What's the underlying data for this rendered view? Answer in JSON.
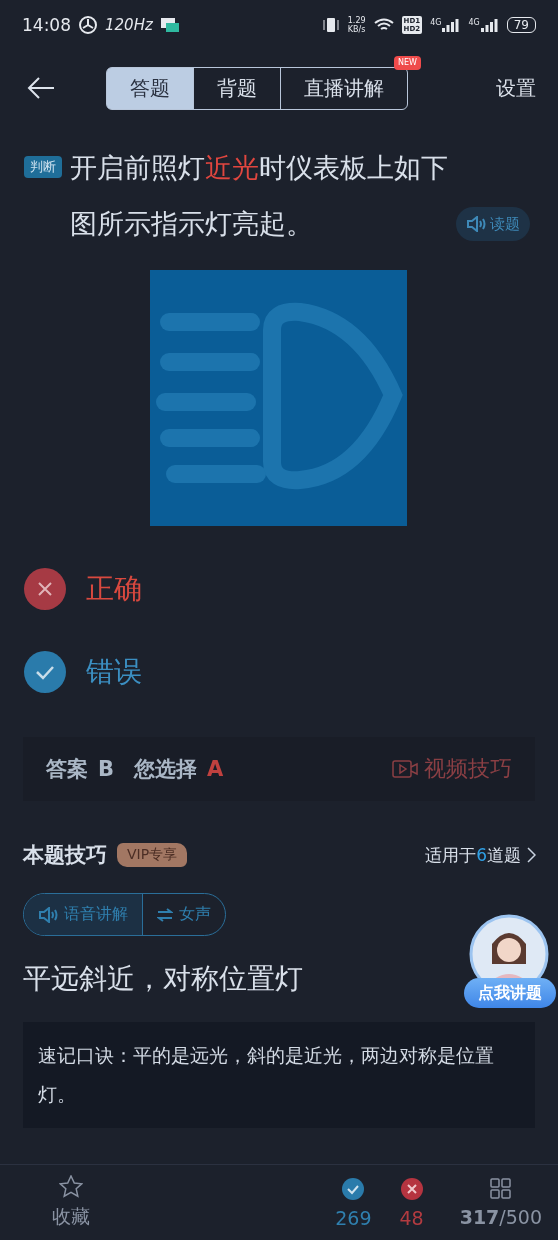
{
  "status_bar": {
    "time": "14:08",
    "refresh": "120Hz",
    "speed": [
      "1.29",
      "KB/s"
    ],
    "hd": [
      "HD1",
      "HD2"
    ],
    "networks": [
      "4G",
      "4G"
    ],
    "battery": "79"
  },
  "header": {
    "tabs": [
      {
        "label": "答题",
        "selected": true
      },
      {
        "label": "背题",
        "selected": false
      },
      {
        "label": "直播讲解",
        "selected": false,
        "badge": "NEW"
      }
    ],
    "settings": "设置"
  },
  "question": {
    "tag": "判断",
    "parts": [
      {
        "text": "开启前照灯",
        "highlight": false
      },
      {
        "text": "近光",
        "highlight": true
      },
      {
        "text": "时仪表板上如下图所示指示灯亮起。",
        "highlight": false
      }
    ],
    "read_button": "读题"
  },
  "options": [
    {
      "label": "正确",
      "kind": "wrong"
    },
    {
      "label": "错误",
      "kind": "right"
    }
  ],
  "answer_bar": {
    "answer_label": "答案",
    "answer": "B",
    "choice_label": "您选择",
    "choice": "A",
    "video": "视频技巧"
  },
  "tips": {
    "title": "本题技巧",
    "vip": "VIP专享",
    "applies_prefix": "适用于",
    "applies_count": "6",
    "applies_suffix": "道题",
    "voice": "语音讲解",
    "voice_switch": "女声",
    "headline": "平远斜近，对称位置灯",
    "mnemonic": "速记口诀：平的是远光，斜的是近光，两边对称是位置灯。",
    "tutor": "点我讲题"
  },
  "bottom_bar": {
    "favorite": "收藏",
    "right_count": "269",
    "wrong_count": "48",
    "progress_done": "317",
    "progress_total": "/500"
  }
}
